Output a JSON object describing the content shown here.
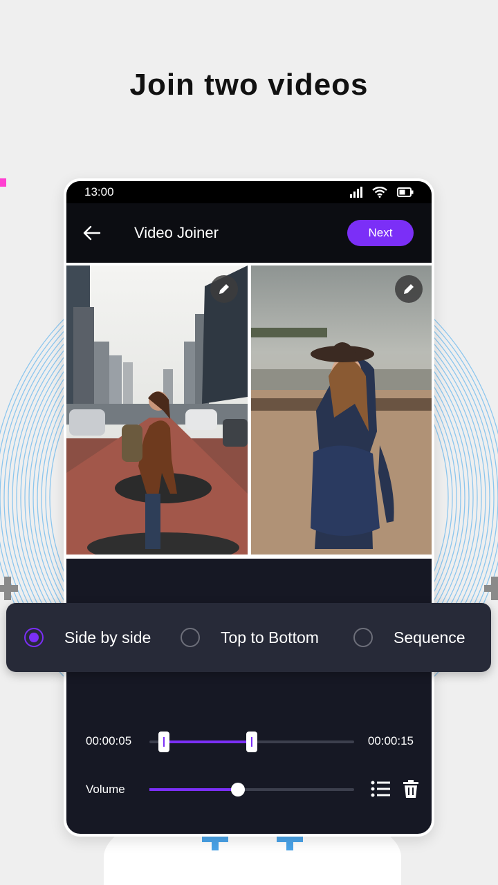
{
  "headline": "Join two videos",
  "status_bar": {
    "time": "13:00",
    "icons": [
      "signal-icon",
      "wifi-icon",
      "battery-icon"
    ]
  },
  "app_bar": {
    "title": "Video Joiner",
    "next_label": "Next",
    "back_icon": "arrow-left-icon"
  },
  "preview": {
    "tiles": [
      {
        "name": "video-1",
        "edit_icon": "pencil-icon"
      },
      {
        "name": "video-2",
        "edit_icon": "pencil-icon"
      }
    ]
  },
  "layout_options": [
    {
      "label": "Side by side",
      "selected": true
    },
    {
      "label": "Top to Bottom",
      "selected": false
    },
    {
      "label": "Sequence",
      "selected": false
    }
  ],
  "trim": {
    "start": "00:00:05",
    "end": "00:00:15"
  },
  "volume": {
    "label": "Volume",
    "level": 0.43
  },
  "actions": {
    "list_icon": "list-icon",
    "delete_icon": "trash-icon"
  },
  "colors": {
    "accent": "#7b2ff7",
    "panel": "#272a38",
    "screen_bg": "#161824",
    "app_bar": "#0c0d12"
  }
}
